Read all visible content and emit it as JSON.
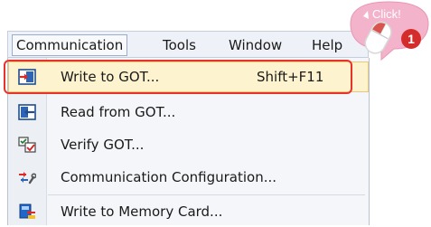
{
  "menubar": {
    "items": [
      {
        "label": "Communication"
      },
      {
        "label": "Tools"
      },
      {
        "label": "Window"
      },
      {
        "label": "Help"
      }
    ]
  },
  "menu": {
    "items": [
      {
        "label": "Write to GOT...",
        "shortcut": "Shift+F11",
        "icon": "write-to-got-icon"
      },
      {
        "label": "Read from GOT...",
        "icon": "read-from-got-icon"
      },
      {
        "label": "Verify GOT...",
        "icon": "verify-got-icon"
      },
      {
        "label": "Communication Configuration...",
        "icon": "communication-config-icon"
      },
      {
        "label": "Write to Memory Card...",
        "icon": "memory-card-icon"
      }
    ]
  },
  "callout": {
    "text": "Click!",
    "step": "1"
  },
  "colors": {
    "highlight": "#fdf3cf",
    "frame": "#e8332b",
    "callout": "#f0a7c2",
    "badge": "#d42b2b"
  }
}
